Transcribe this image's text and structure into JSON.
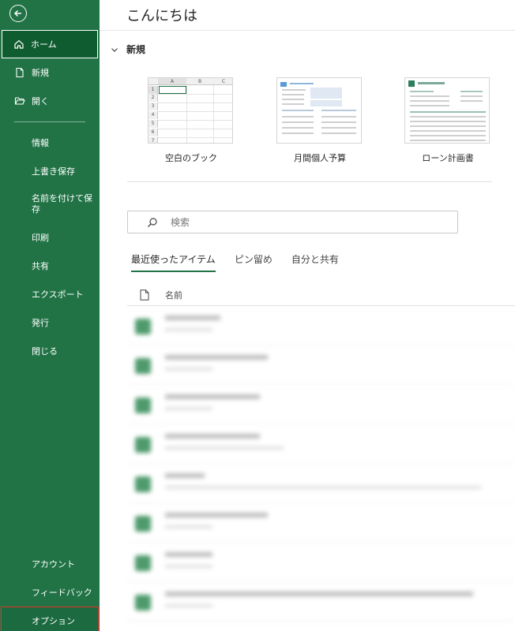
{
  "sidebar": {
    "home": "ホーム",
    "new": "新規",
    "open": "開く",
    "info": "情報",
    "save": "上書き保存",
    "save_as": "名前を付けて保存",
    "print": "印刷",
    "share": "共有",
    "export": "エクスポート",
    "publish": "発行",
    "close": "閉じる",
    "account": "アカウント",
    "feedback": "フィードバック",
    "options": "オプション"
  },
  "main": {
    "greeting": "こんにちは",
    "new_section": "新規",
    "templates": [
      {
        "label": "空白のブック"
      },
      {
        "label": "月間個人予算"
      },
      {
        "label": "ローン計画書"
      }
    ],
    "search_placeholder": "検索",
    "tabs": [
      "最近使ったアイテム",
      "ピン留め",
      "自分と共有"
    ],
    "list_header": "名前"
  },
  "thumb": {
    "cols": [
      "A",
      "B",
      "C"
    ],
    "rows": [
      "1",
      "2",
      "3",
      "4",
      "5",
      "6",
      "7"
    ]
  },
  "colors": {
    "sidebar_bg": "#217346",
    "active_bg": "#0e5c2f",
    "options_border": "#e8312a"
  }
}
